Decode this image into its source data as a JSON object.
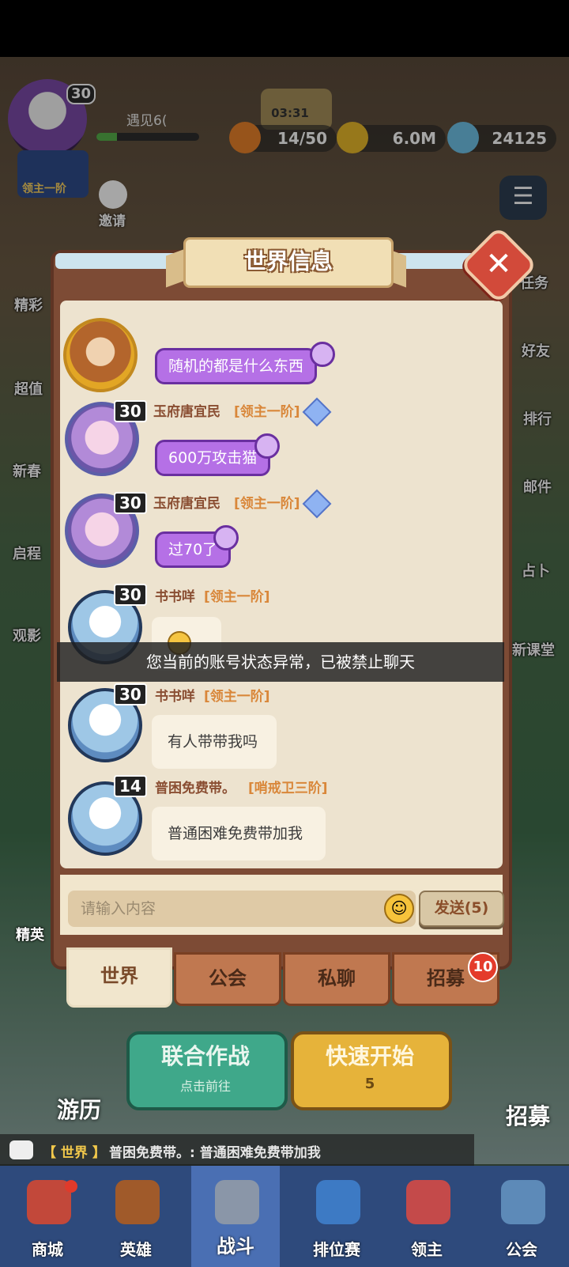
{
  "hud": {
    "player_level": "30",
    "player_name": "遇见6(",
    "player_rank": "领主一阶",
    "timer": "03:31",
    "stamina": "14/50",
    "gold": "6.0M",
    "gems": "24125",
    "invite_label": "邀请"
  },
  "side_menu_left": [
    "精彩",
    "超值",
    "新春",
    "启程",
    "观影"
  ],
  "side_menu_right": [
    "任务",
    "好友",
    "排行",
    "邮件",
    "占卜",
    "新课堂"
  ],
  "dialog": {
    "title": "世界信息",
    "messages": [
      {
        "avatar": "lion-avatar",
        "text": "随机的都是什么东西"
      },
      {
        "level": "30",
        "sender": "玉府唐宜民",
        "rank": "[领主一阶]",
        "text": "600万攻击猫"
      },
      {
        "level": "30",
        "sender": "玉府唐宜民",
        "rank": "[领主一阶]",
        "text": "过70了"
      },
      {
        "level": "30",
        "sender": "书书咩",
        "rank": "[领主一阶]",
        "text": ""
      },
      {
        "level": "30",
        "sender": "书书咩",
        "rank": "[领主一阶]",
        "text": "有人带带我吗"
      },
      {
        "level": "14",
        "sender": "普困免费带。",
        "rank": "[哨戒卫三阶]",
        "text": "普通困难免费带加我"
      }
    ],
    "toast": "您当前的账号状态异常，已被禁止聊天",
    "input_placeholder": "请输入内容",
    "send_label": "发送(5)",
    "tabs": [
      {
        "label": "世界",
        "active": true
      },
      {
        "label": "公会",
        "active": false
      },
      {
        "label": "私聊",
        "active": false
      },
      {
        "label": "招募",
        "active": false,
        "badge": "10"
      }
    ]
  },
  "scene": {
    "coop_label": "联合作战",
    "coop_sub": "点击前往",
    "quick_label": "快速开始",
    "quick_cost": "5",
    "travel_label": "游历",
    "recruit_label": "招募",
    "elite_label": "精英"
  },
  "ticker": {
    "channel": "【 世界 】",
    "text": "普困免费带。: 普通困难免费带加我"
  },
  "nav": [
    "商城",
    "英雄",
    "战斗",
    "排位赛",
    "领主",
    "公会"
  ],
  "colors": {
    "dialog_frame": "#7d4b35",
    "panel": "#ede3cf",
    "accent_purple": "#b570e6",
    "nav_bg": "#2e4a7c"
  }
}
